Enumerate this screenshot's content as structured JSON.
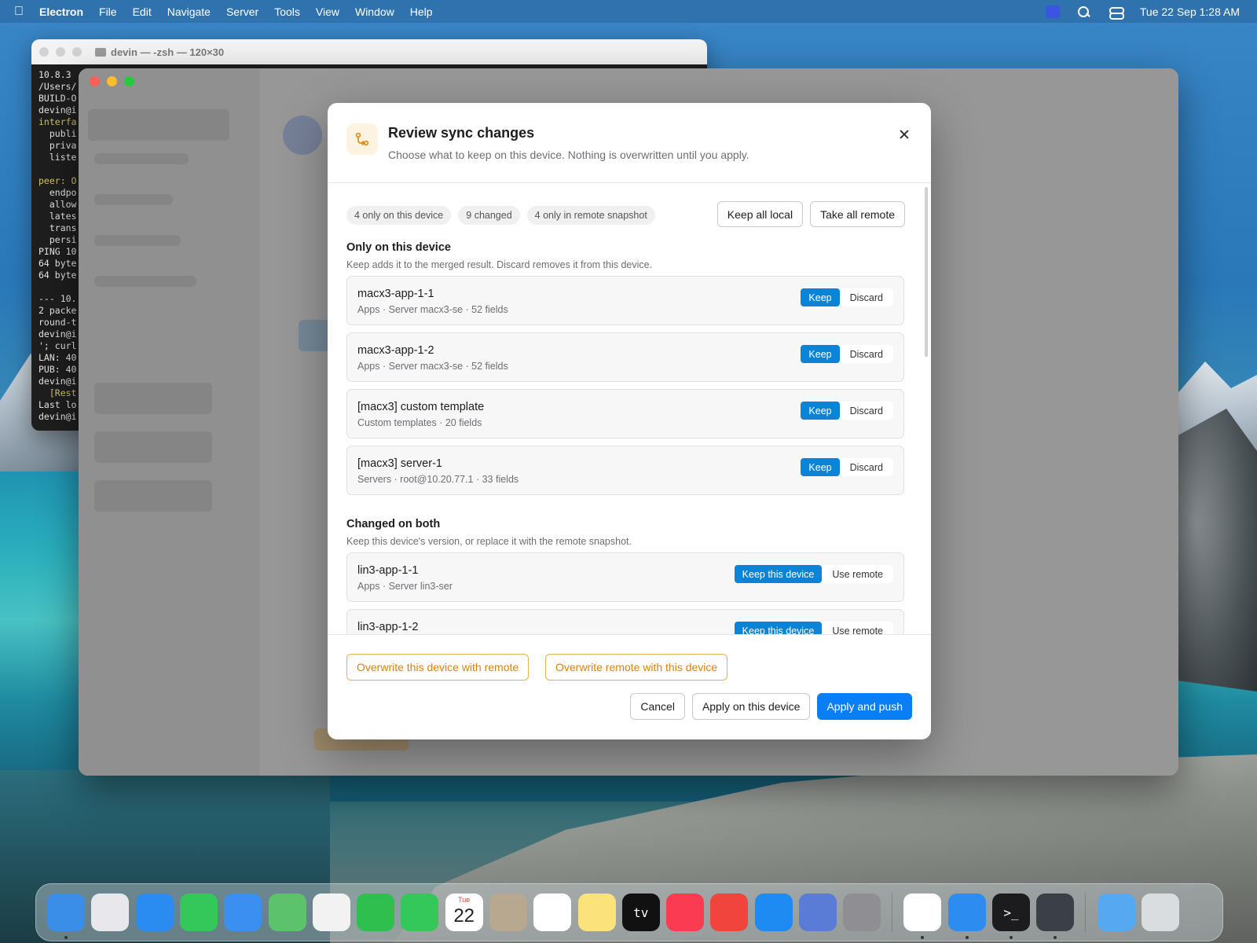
{
  "menubar": {
    "app_name": "Electron",
    "items": [
      "File",
      "Edit",
      "Navigate",
      "Server",
      "Tools",
      "View",
      "Window",
      "Help"
    ],
    "clock": "Tue 22 Sep  1:28 AM"
  },
  "terminal": {
    "title": "devin — -zsh — 120×30",
    "lines": [
      "10.8.3",
      "/Users/",
      "BUILD-O",
      "devin@i",
      "interfa",
      "  publi",
      "  priva",
      "  liste",
      "",
      "peer: O",
      "  endpo",
      "  allow",
      "  lates",
      "  trans",
      "  persi",
      "PING 10",
      "64 byte",
      "64 byte",
      "",
      "--- 10.",
      "2 packe",
      "round-t",
      "devin@i",
      "'; curl",
      "LAN: 40",
      "PUB: 40",
      "devin@i",
      "  [Rest",
      "Last lo",
      "devin@i"
    ]
  },
  "modal": {
    "title": "Review sync changes",
    "subtitle": "Choose what to keep on this device. Nothing is overwritten until you apply.",
    "chips": [
      "4 only on this device",
      "9 changed",
      "4 only in remote snapshot"
    ],
    "keep_all_local": "Keep all local",
    "take_all_remote": "Take all remote",
    "section_local": {
      "title": "Only on this device",
      "desc": "Keep adds it to the merged result. Discard removes it from this device.",
      "items": [
        {
          "name": "macx3-app-1-1",
          "meta": "Apps · Server macx3-se · 52 fields",
          "primary": "Keep",
          "secondary": "Discard"
        },
        {
          "name": "macx3-app-1-2",
          "meta": "Apps · Server macx3-se · 52 fields",
          "primary": "Keep",
          "secondary": "Discard"
        },
        {
          "name": "[macx3] custom template",
          "meta": "Custom templates · 20 fields",
          "primary": "Keep",
          "secondary": "Discard"
        },
        {
          "name": "[macx3] server-1",
          "meta": "Servers · root@10.20.77.1 · 33 fields",
          "primary": "Keep",
          "secondary": "Discard"
        }
      ]
    },
    "section_changed": {
      "title": "Changed on both",
      "desc": "Keep this device's version, or replace it with the remote snapshot.",
      "items": [
        {
          "name": "lin3-app-1-1",
          "meta": "Apps · Server lin3-ser",
          "primary": "Keep this device",
          "secondary": "Use remote"
        },
        {
          "name": "lin3-app-1-2",
          "meta": "",
          "primary": "Keep this device",
          "secondary": "Use remote"
        }
      ]
    },
    "overwrite_local": "Overwrite this device with remote",
    "overwrite_remote": "Overwrite remote with this device",
    "cancel": "Cancel",
    "apply_local": "Apply on this device",
    "apply_push": "Apply and push"
  },
  "dock": {
    "apps": [
      {
        "icon": "finder-icon",
        "color": "#3a8ee8"
      },
      {
        "icon": "launchpad-icon",
        "color": "#e8e8ec"
      },
      {
        "icon": "safari-icon",
        "color": "#2a8cf0"
      },
      {
        "icon": "messages-icon",
        "color": "#34c759"
      },
      {
        "icon": "mail-icon",
        "color": "#3b8ff0"
      },
      {
        "icon": "maps-icon",
        "color": "#5cc26b"
      },
      {
        "icon": "photos-icon",
        "color": "#f2f2f2"
      },
      {
        "icon": "facetime-icon",
        "color": "#2fbf4f"
      },
      {
        "icon": "phone-icon",
        "color": "#34c759"
      },
      {
        "icon": "calendar-icon",
        "color": "#ffffff",
        "label": "22",
        "sub": "Tue"
      },
      {
        "icon": "contacts-icon",
        "color": "#b8a88f"
      },
      {
        "icon": "reminders-icon",
        "color": "#ffffff"
      },
      {
        "icon": "notes-icon",
        "color": "#fbe27a"
      },
      {
        "icon": "appletv-icon",
        "color": "#111111",
        "label": "tv"
      },
      {
        "icon": "music-icon",
        "color": "#fb3b51"
      },
      {
        "icon": "rocket-icon",
        "color": "#f0443c"
      },
      {
        "icon": "appstore-icon",
        "color": "#1d8bf2"
      },
      {
        "icon": "simulator-icon",
        "color": "#5a7bd6"
      },
      {
        "icon": "settings-icon",
        "color": "#8e8e93"
      }
    ],
    "running": [
      {
        "icon": "chrome-icon",
        "color": "#ffffff"
      },
      {
        "icon": "files-icon",
        "color": "#2d8cf0"
      },
      {
        "icon": "terminal-icon",
        "color": "#1c1c1e",
        "label": ">_"
      },
      {
        "icon": "electron-icon",
        "color": "#3a3f48"
      }
    ],
    "trash": [
      {
        "icon": "downloads-folder-icon",
        "color": "#56a8f0"
      },
      {
        "icon": "trash-icon",
        "color": "#d9dde0"
      }
    ]
  }
}
